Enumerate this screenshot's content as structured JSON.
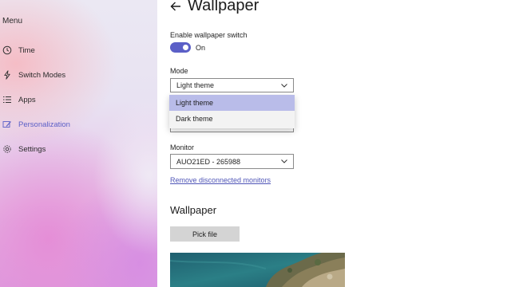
{
  "sidebar": {
    "title": "Menu",
    "items": [
      {
        "label": "Time",
        "icon": "clock-icon"
      },
      {
        "label": "Switch Modes",
        "icon": "bolt-icon"
      },
      {
        "label": "Apps",
        "icon": "list-icon"
      },
      {
        "label": "Personalization",
        "icon": "brush-icon",
        "active": true
      },
      {
        "label": "Settings",
        "icon": "gear-icon"
      }
    ]
  },
  "header": {
    "title": "Wallpaper",
    "back_icon": "back-arrow-icon"
  },
  "switch_section": {
    "label": "Enable wallpaper switch",
    "state_label": "On",
    "enabled": true
  },
  "mode": {
    "label": "Mode",
    "selected": "Light theme",
    "options": [
      "Light theme",
      "Dark theme"
    ]
  },
  "monitor": {
    "label": "Monitor",
    "selected": "AUO21ED - 265988"
  },
  "remove_link": "Remove disconnected monitors",
  "wallpaper_section": {
    "title": "Wallpaper",
    "pick_button": "Pick file"
  },
  "colors": {
    "accent": "#5b5fc7",
    "link": "#4f55b7",
    "dropdown_highlight": "#b9bce9"
  }
}
